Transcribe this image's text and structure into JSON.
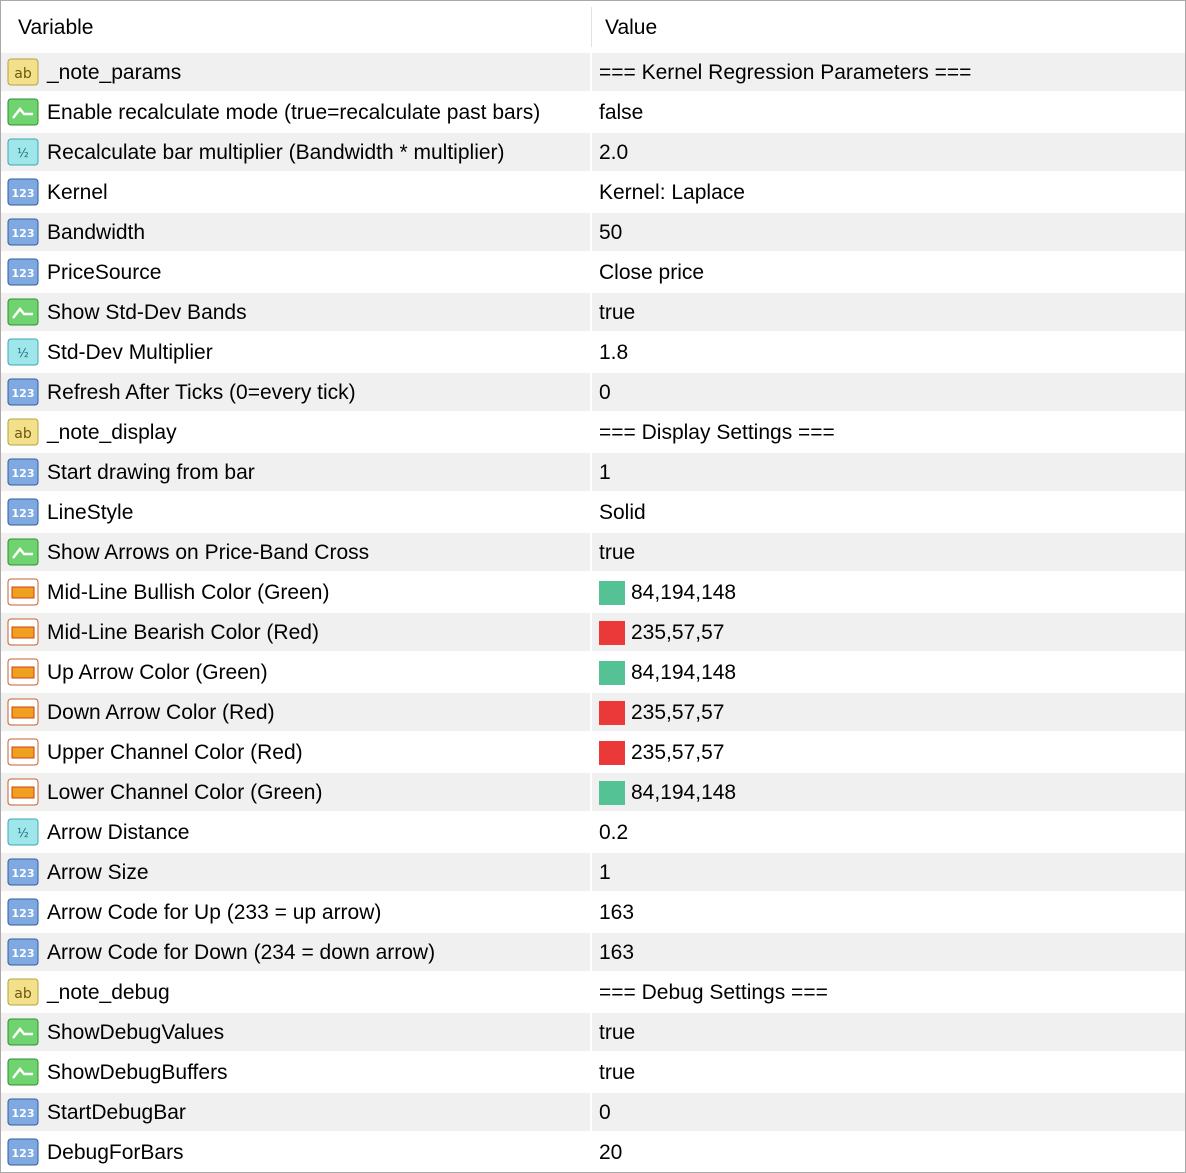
{
  "header": {
    "variable": "Variable",
    "value": "Value"
  },
  "rows": [
    {
      "icon": "string-icon",
      "name": "_note_params",
      "value": "=== Kernel Regression Parameters ==="
    },
    {
      "icon": "bool-icon",
      "name": "Enable recalculate mode (true=recalculate past bars)",
      "value": "false"
    },
    {
      "icon": "double-icon",
      "name": "Recalculate bar multiplier (Bandwidth * multiplier)",
      "value": "2.0"
    },
    {
      "icon": "int-icon",
      "name": "Kernel",
      "value": "Kernel: Laplace"
    },
    {
      "icon": "int-icon",
      "name": "Bandwidth",
      "value": "50"
    },
    {
      "icon": "int-icon",
      "name": "PriceSource",
      "value": "Close price"
    },
    {
      "icon": "bool-icon",
      "name": "Show Std-Dev Bands",
      "value": "true"
    },
    {
      "icon": "double-icon",
      "name": "Std-Dev Multiplier",
      "value": "1.8"
    },
    {
      "icon": "int-icon",
      "name": "Refresh After Ticks (0=every tick)",
      "value": "0"
    },
    {
      "icon": "string-icon",
      "name": "_note_display",
      "value": "=== Display Settings ==="
    },
    {
      "icon": "int-icon",
      "name": "Start drawing from bar",
      "value": "1"
    },
    {
      "icon": "int-icon",
      "name": "LineStyle",
      "value": "Solid"
    },
    {
      "icon": "bool-icon",
      "name": "Show Arrows on Price-Band Cross",
      "value": "true"
    },
    {
      "icon": "color-icon",
      "name": "Mid-Line Bullish Color (Green)",
      "value": "84,194,148",
      "swatch": "#54c294"
    },
    {
      "icon": "color-icon",
      "name": "Mid-Line Bearish Color (Red)",
      "value": "235,57,57",
      "swatch": "#eb3939"
    },
    {
      "icon": "color-icon",
      "name": "Up Arrow Color (Green)",
      "value": "84,194,148",
      "swatch": "#54c294"
    },
    {
      "icon": "color-icon",
      "name": "Down Arrow Color (Red)",
      "value": "235,57,57",
      "swatch": "#eb3939"
    },
    {
      "icon": "color-icon",
      "name": "Upper Channel Color (Red)",
      "value": "235,57,57",
      "swatch": "#eb3939"
    },
    {
      "icon": "color-icon",
      "name": "Lower Channel Color (Green)",
      "value": "84,194,148",
      "swatch": "#54c294"
    },
    {
      "icon": "double-icon",
      "name": "Arrow Distance",
      "value": "0.2"
    },
    {
      "icon": "int-icon",
      "name": "Arrow Size",
      "value": "1"
    },
    {
      "icon": "int-icon",
      "name": "Arrow Code for Up (233 = up arrow)",
      "value": "163"
    },
    {
      "icon": "int-icon",
      "name": "Arrow Code for Down (234 = down arrow)",
      "value": "163"
    },
    {
      "icon": "string-icon",
      "name": "_note_debug",
      "value": "=== Debug Settings ==="
    },
    {
      "icon": "bool-icon",
      "name": "ShowDebugValues",
      "value": "true"
    },
    {
      "icon": "bool-icon",
      "name": "ShowDebugBuffers",
      "value": "true"
    },
    {
      "icon": "int-icon",
      "name": "StartDebugBar",
      "value": "0"
    },
    {
      "icon": "int-icon",
      "name": "DebugForBars",
      "value": "20"
    }
  ]
}
